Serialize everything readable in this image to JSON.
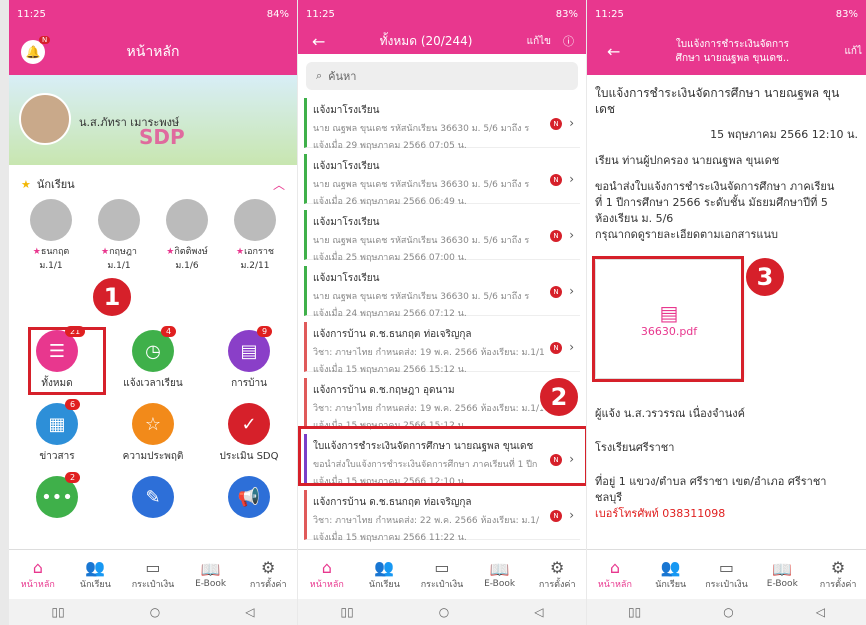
{
  "p1": {
    "time": "11:25",
    "battery": "84%",
    "title": "หน้าหลัก",
    "bell_badge": "N",
    "user": "น.ส.ภัทรา เมาระพงษ์",
    "section": "นักเรียน",
    "students": [
      {
        "name": "ธนกฤต",
        "grade": "ม.1/1"
      },
      {
        "name": "กฤษฎา",
        "grade": "ม.1/1"
      },
      {
        "name": "กิตติพงษ์",
        "grade": "ม.1/6"
      },
      {
        "name": "เอกราช",
        "grade": "ม.2/11"
      }
    ],
    "menu": [
      {
        "label": "ทั้งหมด",
        "badge": "21",
        "color": "#e8378e",
        "icon": "list-icon"
      },
      {
        "label": "แจ้งเวลาเรียน",
        "badge": "4",
        "color": "#3fb04a",
        "icon": "clock-icon"
      },
      {
        "label": "การบ้าน",
        "badge": "9",
        "color": "#8a3fc8",
        "icon": "book-icon"
      },
      {
        "label": "ข่าวสาร",
        "badge": "6",
        "color": "#2d8fd8",
        "icon": "news-icon"
      },
      {
        "label": "ความประพฤติ",
        "badge": "",
        "color": "#f28a1a",
        "icon": "star-icon"
      },
      {
        "label": "ประเมิน SDQ",
        "badge": "",
        "color": "#d6202a",
        "icon": "check-icon"
      },
      {
        "label": "",
        "badge": "2",
        "color": "#3fb04a",
        "icon": "chat-icon"
      },
      {
        "label": "",
        "badge": "",
        "color": "#2d6fd8",
        "icon": "pin-icon"
      },
      {
        "label": "",
        "badge": "",
        "color": "#2d6fd8",
        "icon": "megaphone-icon"
      }
    ]
  },
  "p2": {
    "time": "11:25",
    "battery": "83%",
    "title": "ทั้งหมด (20/244)",
    "edit": "แก้ไข",
    "search": "ค้นหา",
    "items": [
      {
        "title": "แจ้งมาโรงเรียน",
        "body": "นาย ณฐพล ขุนเดช รหัสนักเรียน 36630 ม. 5/6 มาถึง ร",
        "date": "แจ้งเมื่อ 29 พฤษภาคม 2566 07:05 น.",
        "color": "#3fb04a"
      },
      {
        "title": "แจ้งมาโรงเรียน",
        "body": "นาย ณฐพล ขุนเดช รหัสนักเรียน 36630 ม. 5/6 มาถึง ร",
        "date": "แจ้งเมื่อ 26 พฤษภาคม 2566 06:49 น.",
        "color": "#3fb04a"
      },
      {
        "title": "แจ้งมาโรงเรียน",
        "body": "นาย ณฐพล ขุนเดช รหัสนักเรียน 36630 ม. 5/6 มาถึง ร",
        "date": "แจ้งเมื่อ 25 พฤษภาคม 2566 07:00 น.",
        "color": "#3fb04a"
      },
      {
        "title": "แจ้งมาโรงเรียน",
        "body": "นาย ณฐพล ขุนเดช รหัสนักเรียน 36630 ม. 5/6 มาถึง ร",
        "date": "แจ้งเมื่อ 24 พฤษภาคม 2566 07:12 น.",
        "color": "#3fb04a"
      },
      {
        "title": "แจ้งการบ้าน ด.ช.ธนกฤต ท่อเจริญกุล",
        "body": "วิชา: ภาษาไทย กำหนดส่ง: 19 พ.ค. 2566 ห้องเรียน: ม.1/1",
        "date": "แจ้งเมื่อ 15 พฤษภาคม 2566 15:12 น.",
        "color": "#e05a5a"
      },
      {
        "title": "แจ้งการบ้าน ด.ช.กฤษฎา อุดนาม",
        "body": "วิชา: ภาษาไทย กำหนดส่ง: 19 พ.ค. 2566 ห้องเรียน: ม.1/1",
        "date": "แจ้งเมื่อ 15 พฤษภาคม 2566 15:12 น.",
        "color": "#e05a5a"
      },
      {
        "title": "ใบแจ้งการชำระเงินจัดการศึกษา นายณฐพล ขุนเดช",
        "body": "ขอนำส่งใบแจ้งการชำระเงินจัดการศึกษา ภาคเรียนที่ 1 ปีก",
        "date": "แจ้งเมื่อ 15 พฤษภาคม 2566 12:10 น.",
        "color": "#7a3fc8"
      },
      {
        "title": "แจ้งการบ้าน ด.ช.ธนกฤต ท่อเจริญกุล",
        "body": "วิชา: ภาษาไทย กำหนดส่ง: 22 พ.ค. 2566 ห้องเรียน: ม.1/",
        "date": "แจ้งเมื่อ 15 พฤษภาคม 2566 11:22 น.",
        "color": "#e05a5a"
      }
    ]
  },
  "p3": {
    "time": "11:25",
    "battery": "83%",
    "title1": "ใบแจ้งการชำระเงินจัดการ",
    "title2": "ศึกษา นายณฐพล ขุนเดช..",
    "edit": "แก้ไ",
    "heading": "ใบแจ้งการชำระเงินจัดการศึกษา นายณฐพล ขุนเดช",
    "date": "15 พฤษภาคม 2566 12:10 น.",
    "to": "เรียน ท่านผู้ปกครอง นายณฐพล ขุนเดช",
    "body1": "ขอนำส่งใบแจ้งการชำระเงินจัดการศึกษา ภาคเรียน",
    "body2": "ที่ 1 ปีการศึกษา 2566 ระดับชั้น มัธยมศึกษาปีที่ 5",
    "body3": "ห้องเรียน ม. 5/6",
    "body4": "กรุณากดดูรายละเอียดตามเอกสารแนบ",
    "file": "36630.pdf",
    "sender": "ผู้แจ้ง น.ส.วรวรรณ เนื่องจำนงค์",
    "school": "โรงเรียนศรีราชา",
    "addr1": "ที่อยู่ 1 แขวง/ตำบล ศรีราชา เขต/อำเภอ ศรีราชา",
    "addr2": "ชลบุรี",
    "tel": "เบอร์โทรศัพท์ 038311098"
  },
  "nav": [
    "หน้าหลัก",
    "นักเรียน",
    "กระเป๋าเงิน",
    "E-Book",
    "การตั้งค่า"
  ],
  "markers": [
    "1",
    "2",
    "3"
  ]
}
